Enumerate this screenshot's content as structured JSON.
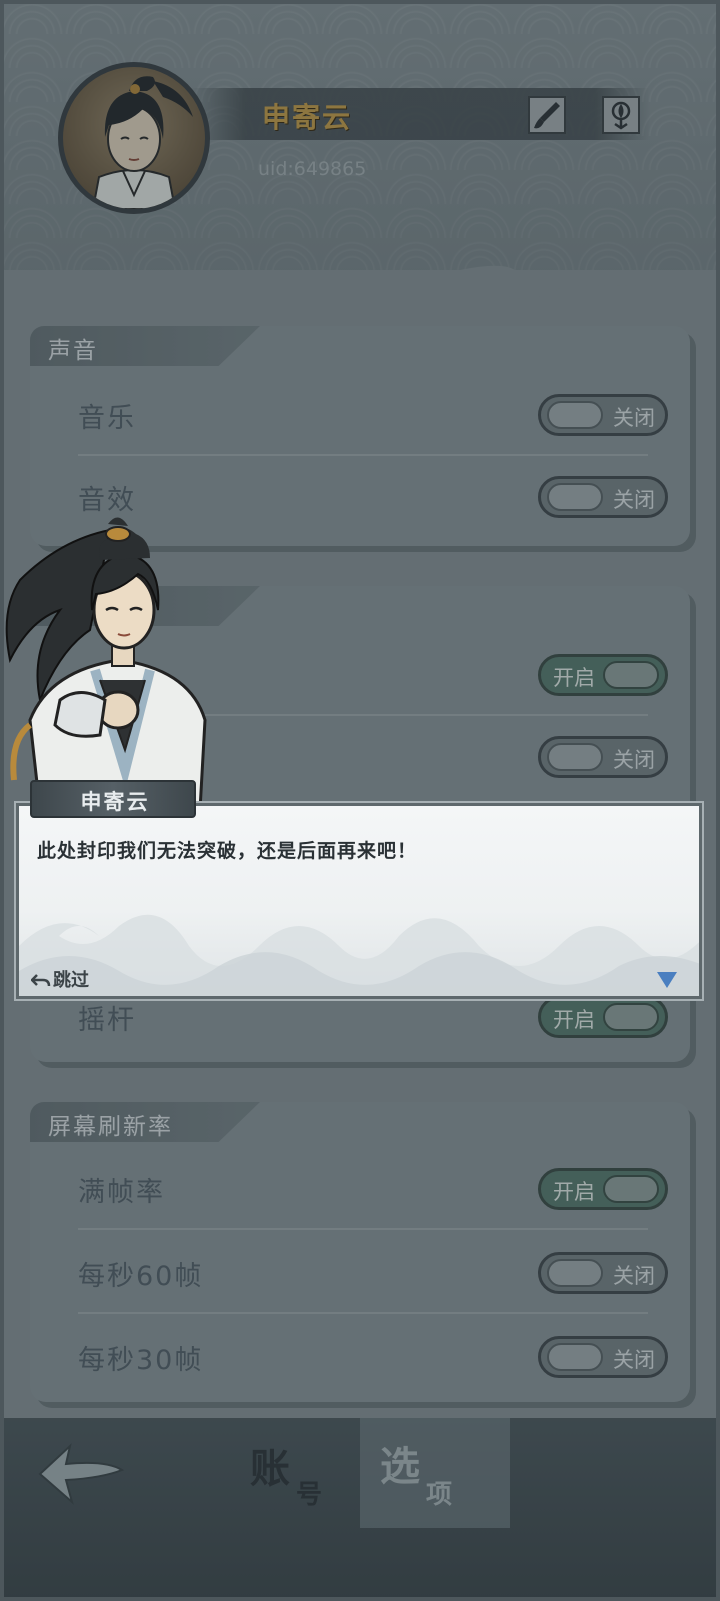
{
  "profile": {
    "name": "申寄云",
    "uid": "uid:649865"
  },
  "header_icons": [
    "brush-icon",
    "lotus-icon"
  ],
  "sections": [
    {
      "title": "声音",
      "rows": [
        {
          "label": "音乐",
          "state": "关闭",
          "on": false
        },
        {
          "label": "音效",
          "state": "关闭",
          "on": false
        }
      ]
    },
    {
      "title": "",
      "rows": [
        {
          "label": "",
          "state": "开启",
          "on": true
        },
        {
          "label": "",
          "state": "关闭",
          "on": false
        },
        {
          "label": "摇杆",
          "state": "开启",
          "on": true
        }
      ]
    },
    {
      "title": "屏幕刷新率",
      "rows": [
        {
          "label": "满帧率",
          "state": "开启",
          "on": true
        },
        {
          "label": "每秒60帧",
          "state": "关闭",
          "on": false
        },
        {
          "label": "每秒30帧",
          "state": "关闭",
          "on": false
        }
      ]
    }
  ],
  "dialog": {
    "speaker": "申寄云",
    "text": "此处封印我们无法突破，还是后面再来吧！",
    "skip_label": "跳过"
  },
  "tabs": [
    {
      "big": "账",
      "small": "号",
      "active": false
    },
    {
      "big": "选",
      "small": "项",
      "active": true
    }
  ],
  "colors": {
    "name_gold": "#c9a04a",
    "toggle_on": "#5a7d70",
    "toggle_off": "#7a8488"
  }
}
